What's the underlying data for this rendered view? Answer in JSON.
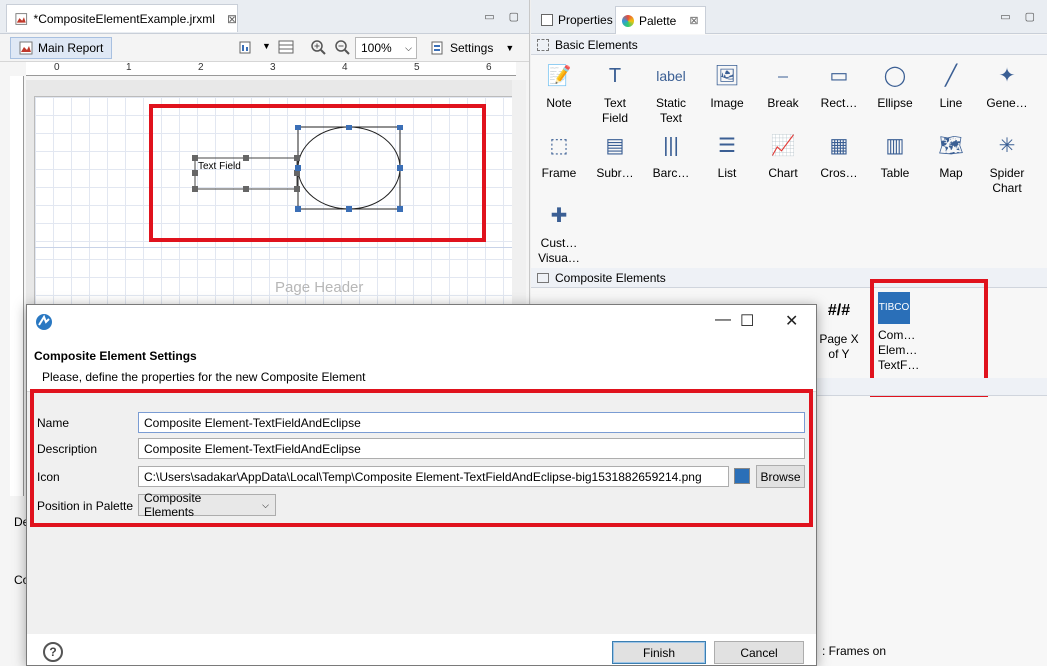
{
  "editor": {
    "tab_title": "*CompositeElementExample.jrxml",
    "main_report_label": "Main Report",
    "zoom_value": "100%",
    "settings_label": "Settings",
    "ruler_marks": [
      "0",
      "1",
      "2",
      "3",
      "4",
      "5",
      "6"
    ],
    "element_label": "Text Field",
    "page_header_label": "Page Header",
    "side_label_1": "De",
    "side_label_2": "Co"
  },
  "rightpane": {
    "tabs": [
      "Properties",
      "Palette"
    ],
    "basic_group": "Basic Elements",
    "basic_items": [
      {
        "label": "Note",
        "icon": "note-icon"
      },
      {
        "label": "Text\nField",
        "icon": "text-field-icon"
      },
      {
        "label": "Static\nText",
        "icon": "static-text-icon"
      },
      {
        "label": "Image",
        "icon": "image-icon"
      },
      {
        "label": "Break",
        "icon": "break-icon"
      },
      {
        "label": "Rect…",
        "icon": "rectangle-icon"
      },
      {
        "label": "Ellipse",
        "icon": "ellipse-icon"
      },
      {
        "label": "Line",
        "icon": "line-icon"
      },
      {
        "label": "Gene…",
        "icon": "generic-icon"
      },
      {
        "label": "Frame",
        "icon": "frame-icon"
      },
      {
        "label": "Subr…",
        "icon": "subreport-icon"
      },
      {
        "label": "Barc…",
        "icon": "barcode-icon"
      },
      {
        "label": "List",
        "icon": "list-icon"
      },
      {
        "label": "Chart",
        "icon": "chart-icon"
      },
      {
        "label": "Cros…",
        "icon": "crosstab-icon"
      },
      {
        "label": "Table",
        "icon": "table-icon"
      },
      {
        "label": "Map",
        "icon": "map-icon"
      },
      {
        "label": "Spider\nChart",
        "icon": "spider-chart-icon"
      },
      {
        "label": "Cust…\nVisua…",
        "icon": "custom-visual-icon"
      }
    ],
    "composite_group": "Composite Elements",
    "composite_items": [
      {
        "label": "Page X\nof Y",
        "icon": "page-x-of-y-icon"
      },
      {
        "label": "Com…\nElem…\nTextF…",
        "icon": "tibco-composite-icon"
      }
    ],
    "status_text": ": Frames on"
  },
  "dialog": {
    "heading": "Composite Element Settings",
    "subtitle": "Please, define the properties for the new Composite Element",
    "name_label": "Name",
    "name_value": "Composite Element-TextFieldAndEclipse",
    "description_label": "Description",
    "description_value": "Composite Element-TextFieldAndEclipse",
    "icon_label": "Icon",
    "icon_value": "C:\\Users\\sadakar\\AppData\\Local\\Temp\\Composite Element-TextFieldAndEclipse-big1531882659214.png",
    "browse_label": "Browse",
    "position_label": "Position in Palette",
    "position_value": "Composite Elements",
    "finish_label": "Finish",
    "cancel_label": "Cancel"
  },
  "colors": {
    "highlight_red": "#e0121d",
    "accent_blue": "#3c7fb1"
  }
}
